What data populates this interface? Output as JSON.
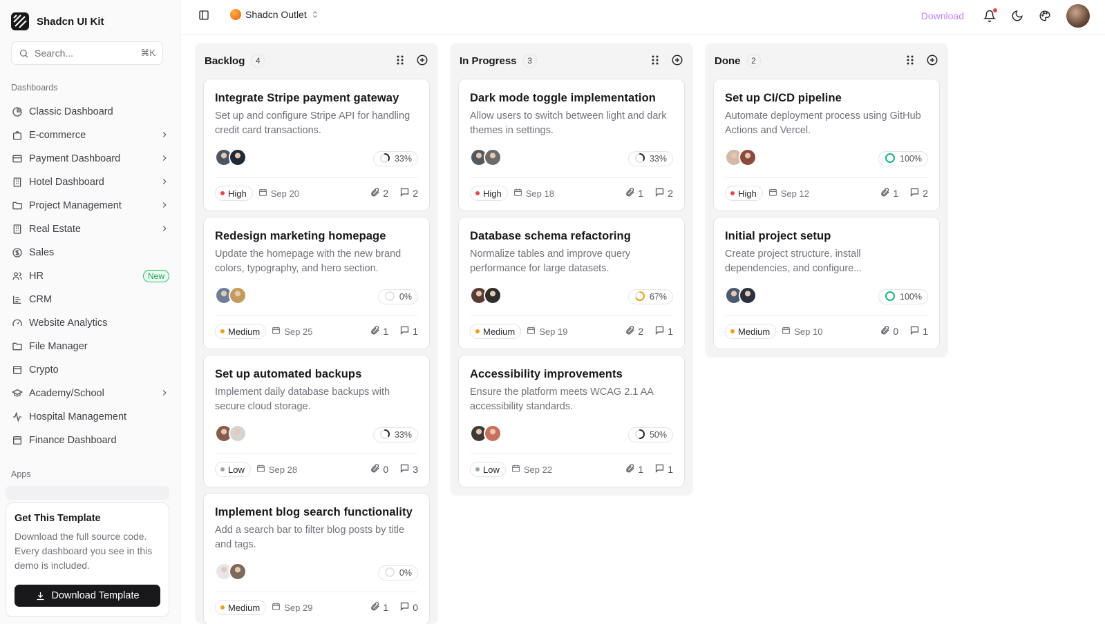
{
  "app": {
    "name": "Shadcn UI Kit"
  },
  "search": {
    "placeholder": "Search...",
    "shortcut": "⌘K"
  },
  "sidebar": {
    "dashboards_label": "Dashboards",
    "apps_label": "Apps",
    "items": [
      {
        "label": "Classic Dashboard",
        "icon": "chart-pie-icon",
        "chevron": false
      },
      {
        "label": "E-commerce",
        "icon": "shopping-bag-icon",
        "chevron": true
      },
      {
        "label": "Payment Dashboard",
        "icon": "credit-card-icon",
        "chevron": true
      },
      {
        "label": "Hotel Dashboard",
        "icon": "building-icon",
        "chevron": true
      },
      {
        "label": "Project Management",
        "icon": "folder-icon",
        "chevron": true
      },
      {
        "label": "Real Estate",
        "icon": "building-icon",
        "chevron": true
      },
      {
        "label": "Sales",
        "icon": "dollar-circle-icon",
        "chevron": false
      },
      {
        "label": "HR",
        "icon": "users-icon",
        "chevron": false,
        "badge": "New"
      },
      {
        "label": "CRM",
        "icon": "list-chart-icon",
        "chevron": false
      },
      {
        "label": "Website Analytics",
        "icon": "gauge-icon",
        "chevron": false
      },
      {
        "label": "File Manager",
        "icon": "folder-icon",
        "chevron": false
      },
      {
        "label": "Crypto",
        "icon": "wallet-icon",
        "chevron": false
      },
      {
        "label": "Academy/School",
        "icon": "graduation-cap-icon",
        "chevron": true
      },
      {
        "label": "Hospital Management",
        "icon": "activity-icon",
        "chevron": false
      },
      {
        "label": "Finance Dashboard",
        "icon": "wallet-icon",
        "chevron": false
      }
    ],
    "promo": {
      "title": "Get This Template",
      "text": "Download the full source code. Every dashboard you see in this demo is included.",
      "button": "Download Template"
    }
  },
  "header": {
    "workspace": "Shadcn Outlet",
    "download": "Download"
  },
  "board": {
    "columns": [
      {
        "title": "Backlog",
        "count": "4",
        "cards": [
          {
            "title": "Integrate Stripe payment gateway",
            "desc": "Set up and configure Stripe API for handling credit card transactions.",
            "progress": "33%",
            "progress_value": 0.33,
            "priority": "High",
            "date": "Sep 20",
            "attachments": "2",
            "comments": "2",
            "avatars": [
              "#4b5563",
              "#1f2937"
            ]
          },
          {
            "title": "Redesign marketing homepage",
            "desc": "Update the homepage with the new brand colors, typography, and hero section.",
            "progress": "0%",
            "progress_value": 0,
            "priority": "Medium",
            "date": "Sep 25",
            "attachments": "1",
            "comments": "1",
            "avatars": [
              "#6b7f99",
              "#c59a5a"
            ]
          },
          {
            "title": "Set up automated backups",
            "desc": "Implement daily database backups with secure cloud storage.",
            "progress": "33%",
            "progress_value": 0.33,
            "priority": "Low",
            "date": "Sep 28",
            "attachments": "0",
            "comments": "3",
            "avatars": [
              "#8a5a4a",
              "#d6d3d1"
            ]
          },
          {
            "title": "Implement blog search functionality",
            "desc": "Add a search bar to filter blog posts by title and tags.",
            "progress": "0%",
            "progress_value": 0,
            "priority": "Medium",
            "date": "Sep 29",
            "attachments": "1",
            "comments": "0",
            "avatars": [
              "#e5e7eb",
              "#7c6a5a"
            ]
          }
        ]
      },
      {
        "title": "In Progress",
        "count": "3",
        "cards": [
          {
            "title": "Dark mode toggle implementation",
            "desc": "Allow users to switch between light and dark themes in settings.",
            "progress": "33%",
            "progress_value": 0.33,
            "priority": "High",
            "date": "Sep 18",
            "attachments": "1",
            "comments": "2",
            "avatars": [
              "#525a60",
              "#6b6b6b"
            ]
          },
          {
            "title": "Database schema refactoring",
            "desc": "Normalize tables and improve query performance for large datasets.",
            "progress": "67%",
            "progress_value": 0.67,
            "priority": "Medium",
            "date": "Sep 19",
            "attachments": "2",
            "comments": "1",
            "avatars": [
              "#5a3a32",
              "#2d2d2d"
            ]
          },
          {
            "title": "Accessibility improvements",
            "desc": "Ensure the platform meets WCAG 2.1 AA accessibility standards.",
            "progress": "50%",
            "progress_value": 0.5,
            "priority": "Low",
            "date": "Sep 22",
            "attachments": "1",
            "comments": "1",
            "avatars": [
              "#3d3a36",
              "#c8705a"
            ]
          }
        ]
      },
      {
        "title": "Done",
        "count": "2",
        "cards": [
          {
            "title": "Set up CI/CD pipeline",
            "desc": "Automate deployment process using GitHub Actions and Vercel.",
            "progress": "100%",
            "progress_value": 1,
            "priority": "High",
            "date": "Sep 12",
            "attachments": "1",
            "comments": "2",
            "avatars": [
              "#d4b8a8",
              "#8b4a3a"
            ]
          },
          {
            "title": "Initial project setup",
            "desc": "Create project structure, install dependencies, and configure...",
            "progress": "100%",
            "progress_value": 1,
            "priority": "Medium",
            "date": "Sep 10",
            "attachments": "0",
            "comments": "1",
            "avatars": [
              "#4a5a70",
              "#2a3040"
            ]
          }
        ]
      }
    ]
  },
  "colors": {
    "high": "#ef4444",
    "medium": "#f59e0b",
    "low": "#94a3b8",
    "done": "#10b981",
    "accent": "#c084fc"
  }
}
